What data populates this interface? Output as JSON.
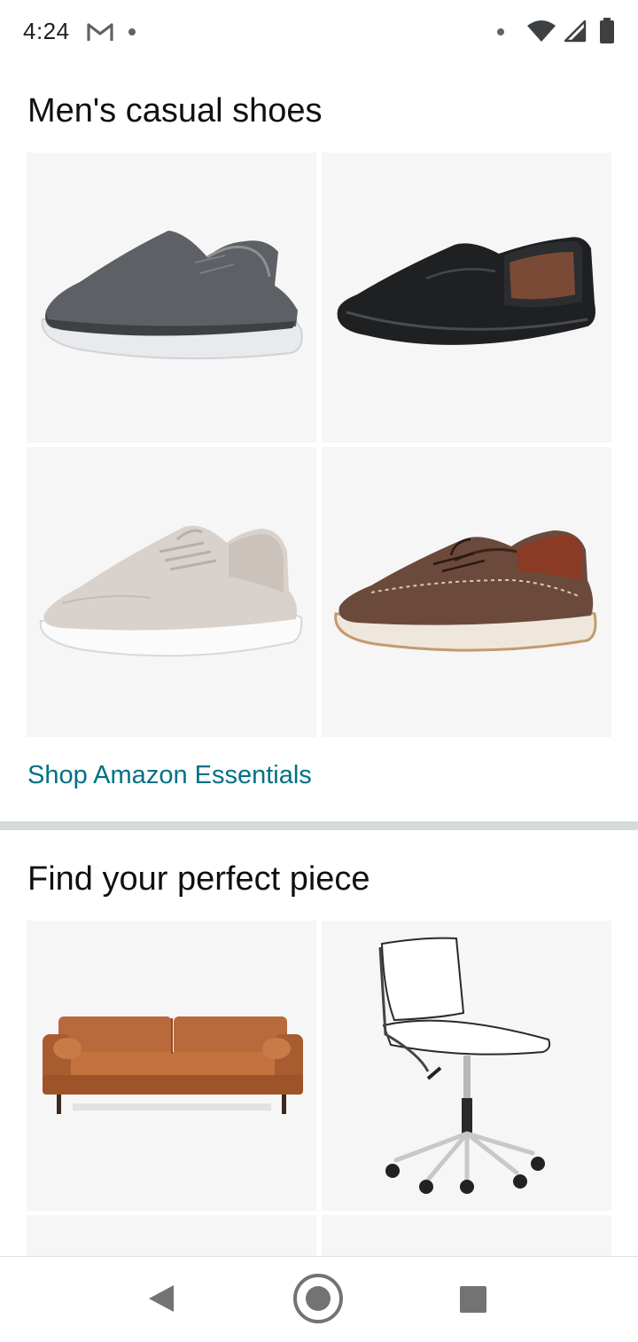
{
  "status_bar": {
    "time": "4:24",
    "icons": [
      "gmail-icon",
      "notification-dot-icon",
      "wifi-icon",
      "cellular-signal-icon",
      "battery-icon"
    ]
  },
  "sections": [
    {
      "title": "Men's casual shoes",
      "products": [
        {
          "icon": "gray-mesh-slip-on-shoe-image"
        },
        {
          "icon": "black-leather-loafer-image"
        },
        {
          "icon": "beige-canvas-sneaker-image"
        },
        {
          "icon": "brown-boat-shoe-image"
        }
      ],
      "link": "Shop Amazon Essentials"
    },
    {
      "title": "Find your perfect piece",
      "products": [
        {
          "icon": "brown-leather-sofa-image"
        },
        {
          "icon": "white-office-chair-image"
        }
      ]
    }
  ],
  "nav_bar": {
    "icons": [
      "back-icon",
      "home-icon",
      "recents-icon"
    ]
  },
  "colors": {
    "link": "#007185",
    "tile_background": "#f6f6f6",
    "divider": "#d5dbdb",
    "text": "#0f1111"
  }
}
